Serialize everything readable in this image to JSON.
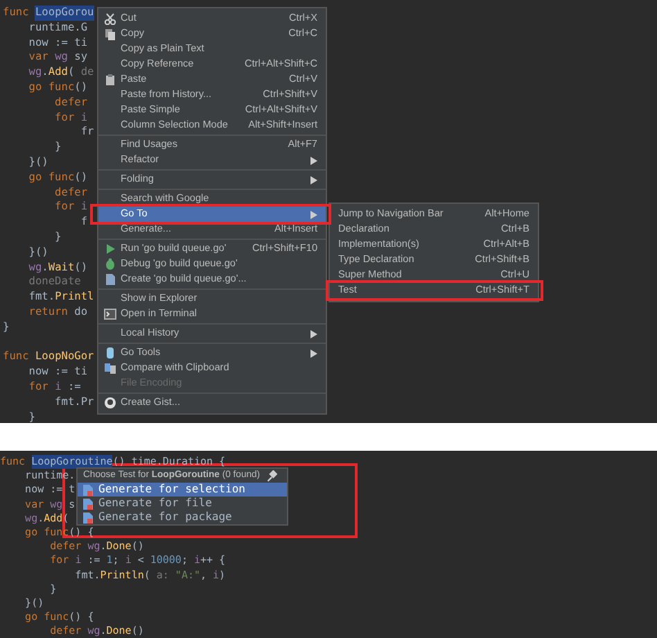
{
  "top_editor": {
    "code_lines": [
      {
        "kind": "code",
        "tokens": [
          {
            "kind": "kw",
            "text": "func "
          },
          {
            "kind": "sel",
            "text": "LoopGorou"
          }
        ]
      },
      {
        "kind": "code",
        "tokens": [
          {
            "kind": "plain",
            "text": "    runtime.G"
          }
        ]
      },
      {
        "kind": "code",
        "tokens": [
          {
            "kind": "plain",
            "text": "    now := ti"
          }
        ]
      },
      {
        "kind": "code",
        "tokens": [
          {
            "kind": "kw",
            "text": "    var "
          },
          {
            "kind": "field",
            "text": "wg"
          },
          {
            "kind": "plain",
            "text": " sy"
          }
        ]
      },
      {
        "kind": "code",
        "tokens": [
          {
            "kind": "field",
            "text": "    wg"
          },
          {
            "kind": "plain",
            "text": "."
          },
          {
            "kind": "fn",
            "text": "Add"
          },
          {
            "kind": "plain",
            "text": "( "
          },
          {
            "kind": "hint",
            "text": "de"
          }
        ]
      },
      {
        "kind": "code",
        "tokens": [
          {
            "kind": "kw",
            "text": "    go func"
          },
          {
            "kind": "plain",
            "text": "()"
          }
        ]
      },
      {
        "kind": "code",
        "tokens": [
          {
            "kind": "kw",
            "text": "        defer"
          }
        ]
      },
      {
        "kind": "code",
        "tokens": [
          {
            "kind": "kw",
            "text": "        for "
          },
          {
            "kind": "field",
            "text": "i"
          }
        ]
      },
      {
        "kind": "code",
        "tokens": [
          {
            "kind": "plain",
            "text": "            fr"
          }
        ]
      },
      {
        "kind": "code",
        "tokens": [
          {
            "kind": "plain",
            "text": "        }"
          }
        ]
      },
      {
        "kind": "code",
        "tokens": [
          {
            "kind": "plain",
            "text": "    }()"
          }
        ]
      },
      {
        "kind": "code",
        "tokens": [
          {
            "kind": "kw",
            "text": "    go func"
          },
          {
            "kind": "plain",
            "text": "()"
          }
        ]
      },
      {
        "kind": "code",
        "tokens": [
          {
            "kind": "kw",
            "text": "        defer"
          }
        ]
      },
      {
        "kind": "code",
        "tokens": [
          {
            "kind": "kw",
            "text": "        for "
          },
          {
            "kind": "field",
            "text": "i"
          }
        ]
      },
      {
        "kind": "code",
        "tokens": [
          {
            "kind": "plain",
            "text": "            f"
          }
        ]
      },
      {
        "kind": "code",
        "tokens": [
          {
            "kind": "plain",
            "text": "        }"
          }
        ]
      },
      {
        "kind": "code",
        "tokens": [
          {
            "kind": "plain",
            "text": "    }()"
          }
        ]
      },
      {
        "kind": "code",
        "tokens": [
          {
            "kind": "field",
            "text": "    wg"
          },
          {
            "kind": "plain",
            "text": "."
          },
          {
            "kind": "fn",
            "text": "Wait"
          },
          {
            "kind": "plain",
            "text": "()"
          }
        ]
      },
      {
        "kind": "code",
        "tokens": [
          {
            "kind": "hint",
            "text": "    doneDate"
          }
        ]
      },
      {
        "kind": "code",
        "tokens": [
          {
            "kind": "plain",
            "text": "    fmt."
          },
          {
            "kind": "fn",
            "text": "Printl"
          }
        ]
      },
      {
        "kind": "code",
        "tokens": [
          {
            "kind": "kw",
            "text": "    return "
          },
          {
            "kind": "plain",
            "text": "do"
          }
        ]
      },
      {
        "kind": "code",
        "tokens": [
          {
            "kind": "plain",
            "text": "}"
          }
        ]
      },
      {
        "kind": "blank"
      },
      {
        "kind": "code",
        "tokens": [
          {
            "kind": "kw",
            "text": "func "
          },
          {
            "kind": "fn",
            "text": "LoopNoGor"
          }
        ]
      },
      {
        "kind": "code",
        "tokens": [
          {
            "kind": "plain",
            "text": "    now := ti"
          }
        ]
      },
      {
        "kind": "code",
        "tokens": [
          {
            "kind": "kw",
            "text": "    for "
          },
          {
            "kind": "field",
            "text": "i"
          },
          {
            "kind": "plain",
            "text": " := "
          }
        ]
      },
      {
        "kind": "code",
        "tokens": [
          {
            "kind": "plain",
            "text": "        fmt.Pr"
          }
        ]
      },
      {
        "kind": "code",
        "tokens": [
          {
            "kind": "plain",
            "text": "    }"
          }
        ]
      }
    ],
    "context_menu": [
      {
        "kind": "item",
        "label": "Cut",
        "shortcut": "Ctrl+X"
      },
      {
        "kind": "item",
        "label": "Copy",
        "shortcut": "Ctrl+C"
      },
      {
        "kind": "item",
        "label": "Copy as Plain Text"
      },
      {
        "kind": "item",
        "label": "Copy Reference",
        "shortcut": "Ctrl+Alt+Shift+C"
      },
      {
        "kind": "item",
        "label": "Paste",
        "shortcut": "Ctrl+V"
      },
      {
        "kind": "item",
        "label": "Paste from History...",
        "shortcut": "Ctrl+Shift+V"
      },
      {
        "kind": "item",
        "label": "Paste Simple",
        "shortcut": "Ctrl+Alt+Shift+V"
      },
      {
        "kind": "item",
        "label": "Column Selection Mode",
        "shortcut": "Alt+Shift+Insert"
      },
      {
        "kind": "separator"
      },
      {
        "kind": "item",
        "label": "Find Usages",
        "shortcut": "Alt+F7"
      },
      {
        "kind": "item",
        "label": "Refactor",
        "submenu": true
      },
      {
        "kind": "separator"
      },
      {
        "kind": "item",
        "label": "Folding",
        "submenu": true
      },
      {
        "kind": "separator"
      },
      {
        "kind": "item",
        "label": "Search with Google"
      },
      {
        "kind": "item",
        "label": "Go To",
        "submenu": true,
        "selected": true,
        "framed": true
      },
      {
        "kind": "item",
        "label": "Generate...",
        "shortcut": "Alt+Insert"
      },
      {
        "kind": "separator"
      },
      {
        "kind": "item",
        "label": "Run 'go build queue.go'",
        "shortcut": "Ctrl+Shift+F10"
      },
      {
        "kind": "item",
        "label": "Debug 'go build queue.go'"
      },
      {
        "kind": "item",
        "label": "Create 'go build queue.go'..."
      },
      {
        "kind": "separator"
      },
      {
        "kind": "item",
        "label": "Show in Explorer"
      },
      {
        "kind": "item",
        "label": "Open in Terminal"
      },
      {
        "kind": "separator"
      },
      {
        "kind": "item",
        "label": "Local History",
        "submenu": true
      },
      {
        "kind": "separator"
      },
      {
        "kind": "item",
        "label": "Go Tools",
        "submenu": true
      },
      {
        "kind": "item",
        "label": "Compare with Clipboard"
      },
      {
        "kind": "item",
        "label": "File Encoding",
        "disabled": true
      },
      {
        "kind": "separator"
      },
      {
        "kind": "item",
        "label": "Create Gist..."
      }
    ],
    "goto_submenu": [
      {
        "label": "Jump to Navigation Bar",
        "shortcut": "Alt+Home"
      },
      {
        "label": "Declaration",
        "shortcut": "Ctrl+B"
      },
      {
        "label": "Implementation(s)",
        "shortcut": "Ctrl+Alt+B"
      },
      {
        "label": "Type Declaration",
        "shortcut": "Ctrl+Shift+B"
      },
      {
        "label": "Super Method",
        "shortcut": "Ctrl+U"
      },
      {
        "label": "Test",
        "shortcut": "Ctrl+Shift+T",
        "framed": true
      }
    ]
  },
  "bottom_editor": {
    "code_lines": [
      {
        "kind": "code",
        "tokens": [
          {
            "kind": "kw",
            "text": "func "
          },
          {
            "kind": "sel",
            "text": "LoopGoroutine"
          },
          {
            "kind": "plain",
            "text": "() time.Duration {"
          }
        ]
      },
      {
        "kind": "code",
        "tokens": [
          {
            "kind": "plain",
            "text": "    runtime."
          }
        ]
      },
      {
        "kind": "code",
        "tokens": [
          {
            "kind": "plain",
            "text": "    now := t"
          }
        ]
      },
      {
        "kind": "code",
        "tokens": [
          {
            "kind": "kw",
            "text": "    var "
          },
          {
            "kind": "field",
            "text": "wg"
          },
          {
            "kind": "plain",
            "text": " s"
          }
        ]
      },
      {
        "kind": "code",
        "tokens": [
          {
            "kind": "field",
            "text": "    wg"
          },
          {
            "kind": "plain",
            "text": "."
          },
          {
            "kind": "fn",
            "text": "Add"
          },
          {
            "kind": "plain",
            "text": "("
          }
        ]
      },
      {
        "kind": "code",
        "tokens": [
          {
            "kind": "kw",
            "text": "    go func"
          },
          {
            "kind": "plain",
            "text": "() {"
          }
        ]
      },
      {
        "kind": "code",
        "tokens": [
          {
            "kind": "kw",
            "text": "        defer "
          },
          {
            "kind": "field",
            "text": "wg"
          },
          {
            "kind": "plain",
            "text": "."
          },
          {
            "kind": "fn",
            "text": "Done"
          },
          {
            "kind": "plain",
            "text": "()"
          }
        ]
      },
      {
        "kind": "code",
        "tokens": [
          {
            "kind": "kw",
            "text": "        for "
          },
          {
            "kind": "field",
            "text": "i"
          },
          {
            "kind": "plain",
            "text": " := "
          },
          {
            "kind": "num",
            "text": "1"
          },
          {
            "kind": "plain",
            "text": "; "
          },
          {
            "kind": "field",
            "text": "i"
          },
          {
            "kind": "plain",
            "text": " < "
          },
          {
            "kind": "num",
            "text": "10000"
          },
          {
            "kind": "plain",
            "text": "; "
          },
          {
            "kind": "field",
            "text": "i"
          },
          {
            "kind": "plain",
            "text": "++ {"
          }
        ]
      },
      {
        "kind": "code",
        "tokens": [
          {
            "kind": "plain",
            "text": "            fmt."
          },
          {
            "kind": "fn",
            "text": "Println"
          },
          {
            "kind": "plain",
            "text": "( "
          },
          {
            "kind": "hint",
            "text": "a:"
          },
          {
            "kind": "str",
            "text": " \"A:\""
          },
          {
            "kind": "plain",
            "text": ", "
          },
          {
            "kind": "field",
            "text": "i"
          },
          {
            "kind": "plain",
            "text": ")"
          }
        ]
      },
      {
        "kind": "code",
        "tokens": [
          {
            "kind": "plain",
            "text": "        }"
          }
        ]
      },
      {
        "kind": "code",
        "tokens": [
          {
            "kind": "plain",
            "text": "    }()"
          }
        ]
      },
      {
        "kind": "code",
        "tokens": [
          {
            "kind": "kw",
            "text": "    go func"
          },
          {
            "kind": "plain",
            "text": "() {"
          }
        ]
      },
      {
        "kind": "code",
        "tokens": [
          {
            "kind": "kw",
            "text": "        defer "
          },
          {
            "kind": "field",
            "text": "wg"
          },
          {
            "kind": "plain",
            "text": "."
          },
          {
            "kind": "fn",
            "text": "Done"
          },
          {
            "kind": "plain",
            "text": "()"
          }
        ]
      }
    ],
    "test_popup": {
      "title": "Choose Test for **LoopGoroutine** (0 found)",
      "framed": true,
      "items": [
        {
          "label": "Generate for selection",
          "selected": true
        },
        {
          "label": "Generate for file",
          "selected": false
        },
        {
          "label": "Generate for package",
          "selected": false
        }
      ]
    }
  }
}
